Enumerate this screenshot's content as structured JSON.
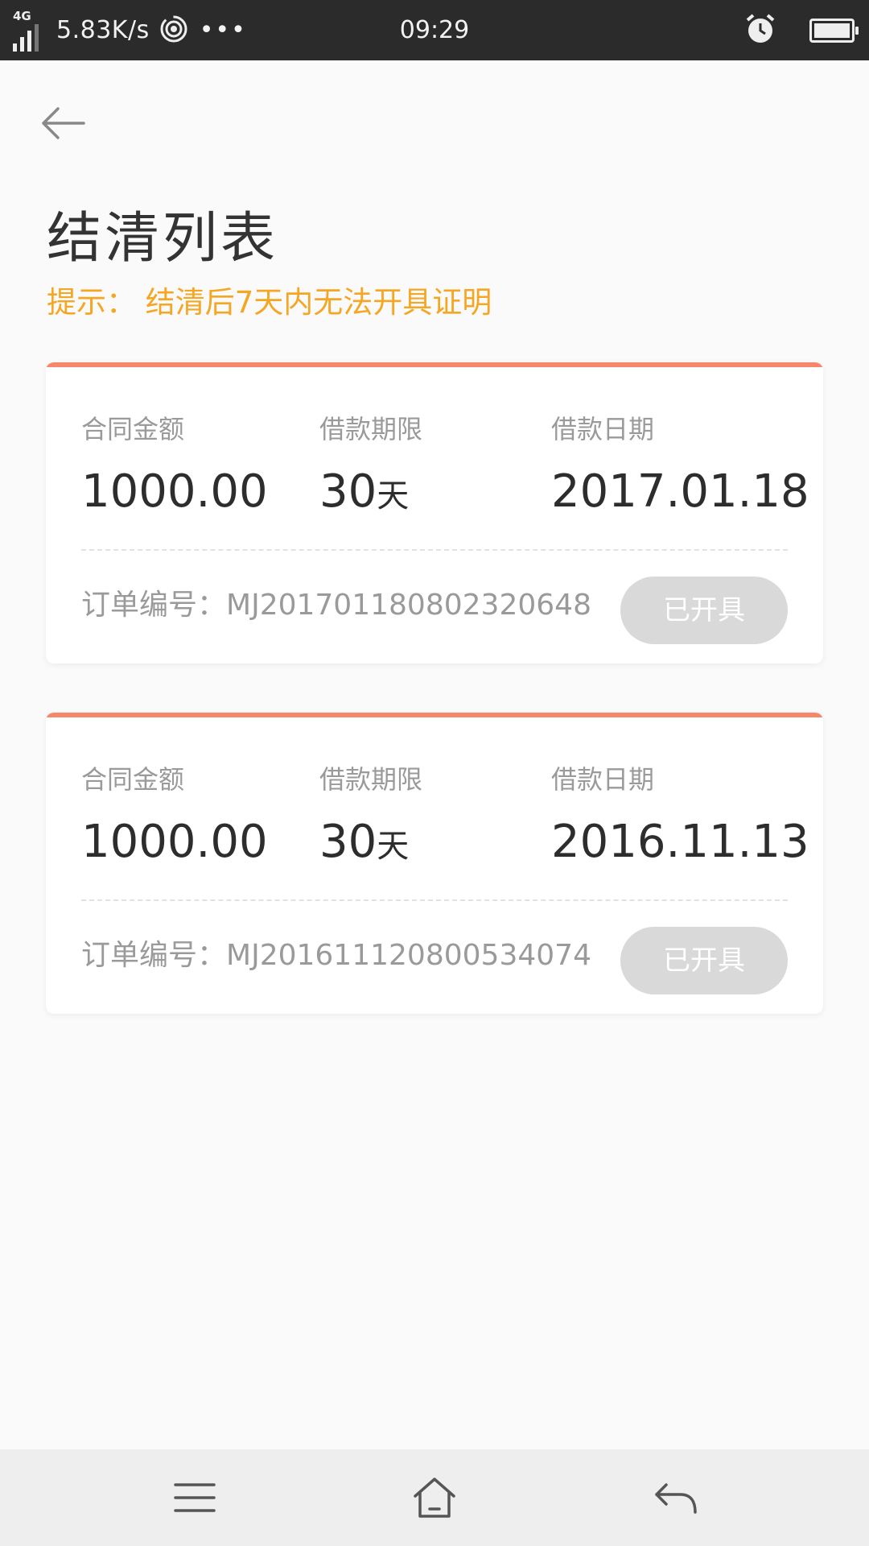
{
  "status_bar": {
    "network": "4G",
    "speed": "5.83K/s",
    "dots": "•••",
    "time": "09:29",
    "icons": [
      "signal-icon",
      "hotspot-icon",
      "alarm-icon",
      "battery-icon"
    ]
  },
  "header": {
    "title": "结清列表",
    "hint": "提示：  结清后7天内无法开具证明"
  },
  "cards": [
    {
      "amount_label": "合同金额",
      "amount": "1000.00",
      "term_label": "借款期限",
      "term_value": "30",
      "term_unit": "天",
      "date_label": "借款日期",
      "date": "2017.01.18",
      "order_label": "订单编号：",
      "order_no": "MJ201701180802320648",
      "button": "已开具"
    },
    {
      "amount_label": "合同金额",
      "amount": "1000.00",
      "term_label": "借款期限",
      "term_value": "30",
      "term_unit": "天",
      "date_label": "借款日期",
      "date": "2016.11.13",
      "order_label": "订单编号：",
      "order_no": "MJ201611120800534074",
      "button": "已开具"
    }
  ],
  "colors": {
    "accent_line": "#f7866a",
    "hint": "#f5a623",
    "button_disabled": "#d9d9d9"
  },
  "nav_bar": {
    "icons": [
      "menu-icon",
      "home-icon",
      "back-icon"
    ]
  }
}
